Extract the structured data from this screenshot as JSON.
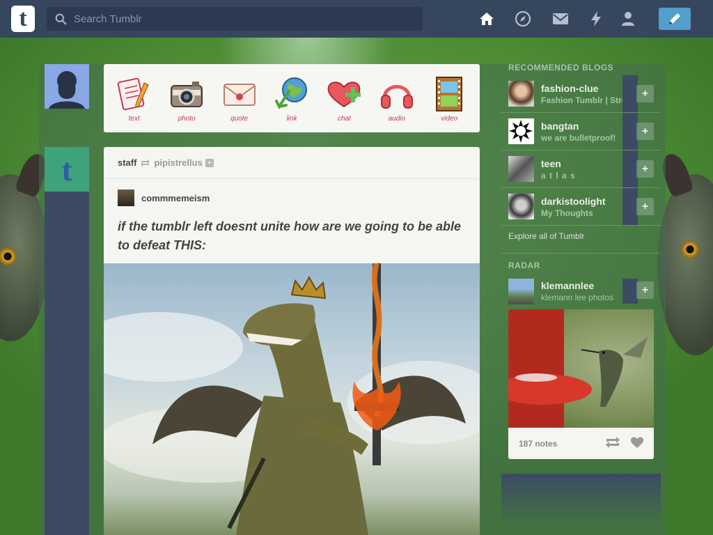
{
  "topbar": {
    "logo": "t",
    "search_placeholder": "Search Tumblr",
    "nav_icons": [
      "home-icon",
      "compass-icon",
      "mail-icon",
      "lightning-icon",
      "person-icon",
      "pencil-icon"
    ]
  },
  "post_types": [
    {
      "label": "text",
      "icon": "notepad-icon"
    },
    {
      "label": "photo",
      "icon": "camera-icon"
    },
    {
      "label": "quote",
      "icon": "envelope-icon"
    },
    {
      "label": "link",
      "icon": "globe-arrow-icon"
    },
    {
      "label": "chat",
      "icon": "heart-plus-icon"
    },
    {
      "label": "audio",
      "icon": "headphones-icon"
    },
    {
      "label": "video",
      "icon": "film-icon"
    }
  ],
  "post": {
    "author": "staff",
    "source": "pipistrellus",
    "follow": "+",
    "sub_author": "commmemeism",
    "text": "if the tumblr left doesnt unite how are we going to be able to defeat THIS:"
  },
  "sidebar": {
    "recommended_heading": "RECOMMENDED BLOGS",
    "recommended": [
      {
        "name": "fashion-clue",
        "sub": "Fashion Tumblr | Street Style"
      },
      {
        "name": "bangtan",
        "sub": "we are bulletproof!"
      },
      {
        "name": "teen",
        "sub": "a t l a s"
      },
      {
        "name": "darkistoolight",
        "sub": "My Thoughts"
      }
    ],
    "follow_label": "+",
    "explore": "Explore all of Tumblr",
    "radar_heading": "RADAR",
    "radar": {
      "name": "klemannlee",
      "sub": "klemann lee photos",
      "notes": "187 notes"
    }
  },
  "colors": {
    "topbar": "#36465d",
    "accent": "#529ecc",
    "sidebar_strip": "#3d4a64"
  }
}
